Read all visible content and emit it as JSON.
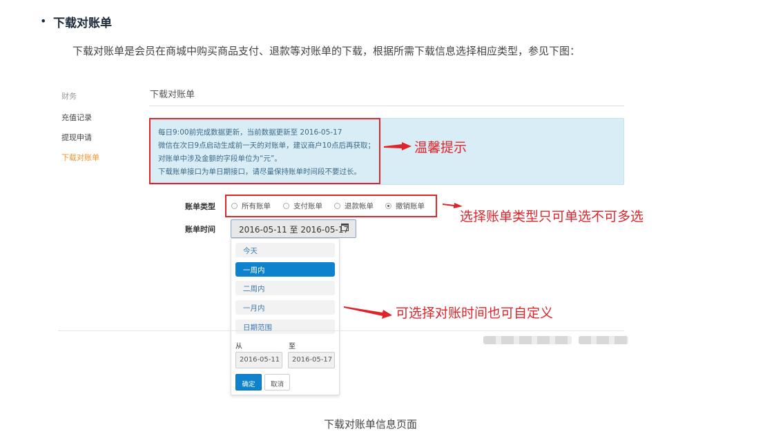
{
  "doc": {
    "heading": "下载对账单",
    "intro": "下载对账单是会员在商城中购买商品支付、退款等对账单的下载，根据所需下载信息选择相应类型，参见下图：",
    "caption": "下载对账单信息页面"
  },
  "sidebar": {
    "header": "财务",
    "items": [
      {
        "label": "充值记录"
      },
      {
        "label": "提现申请"
      },
      {
        "label": "下载对账单"
      }
    ]
  },
  "panel": {
    "title": "下载对账单",
    "notice": [
      "每日9:00前完成数据更新，当前数据更新至 2016-05-17",
      "微信在次日9点启动生成前一天的对账单，建议商户10点后再获取；",
      "对账单中涉及金额的字段单位为“元”。",
      "下载账单接口为单日期接口，请尽量保持账单时间段不要过长。"
    ],
    "bill_type": {
      "label": "账单类型",
      "options": [
        "所有账单",
        "支付账单",
        "退款帐单",
        "撤销账单"
      ],
      "selected": "撤销账单"
    },
    "bill_time": {
      "label": "账单时间",
      "value": "2016-05-11 至 2016-05-17",
      "ranges": [
        "今天",
        "一周内",
        "二周内",
        "一月内",
        "日期范围"
      ],
      "active_range": "一周内",
      "from_label": "从",
      "to_label": "至",
      "from_value": "2016-05-11",
      "to_value": "2016-05-17",
      "ok": "确定",
      "cancel": "取消"
    }
  },
  "annotations": {
    "notice": "温馨提示",
    "type": "选择账单类型只可单选不可多选",
    "time": "可选择对账时间也可自定义"
  },
  "colors": {
    "annotation": "#e0242b",
    "accent": "#0e82cd",
    "notice_bg": "#d9edf7",
    "active_sidebar": "#f0932b"
  }
}
